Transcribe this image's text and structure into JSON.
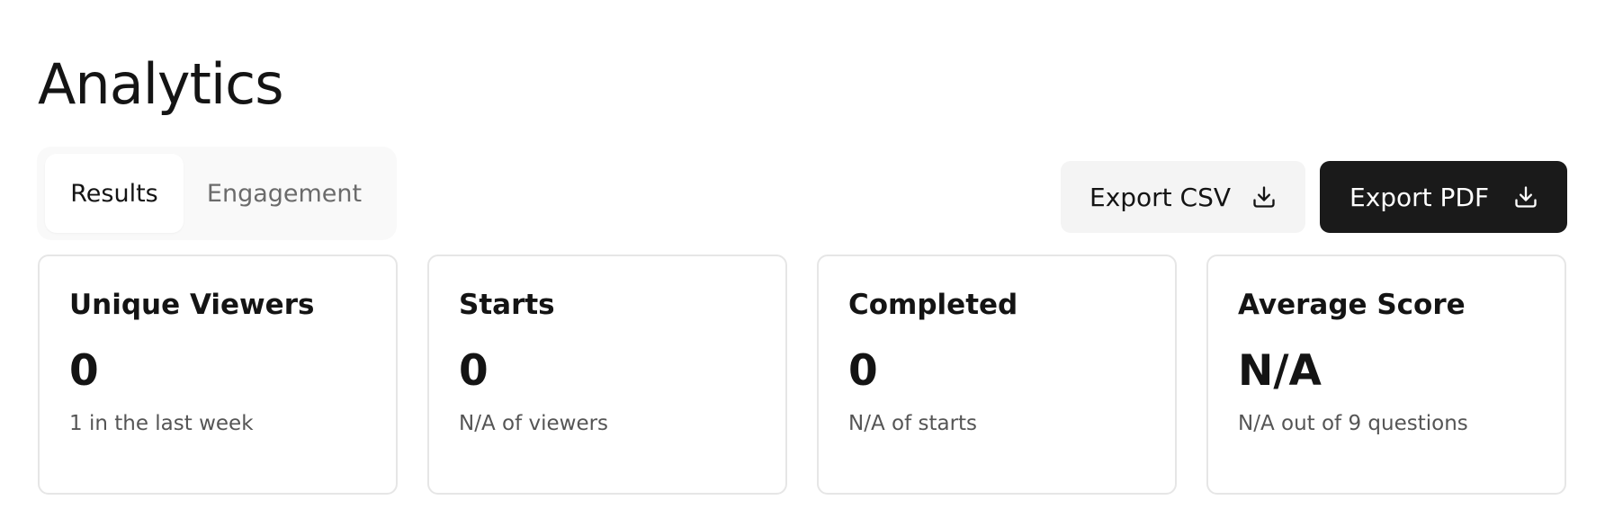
{
  "header": {
    "title": "Analytics"
  },
  "tabs": [
    {
      "label": "Results",
      "active": true
    },
    {
      "label": "Engagement",
      "active": false
    }
  ],
  "actions": {
    "export_csv": {
      "label": "Export CSV",
      "icon": "download-icon"
    },
    "export_pdf": {
      "label": "Export PDF",
      "icon": "download-icon"
    }
  },
  "stats": [
    {
      "title": "Unique Viewers",
      "value": "0",
      "sub": "1 in the last week"
    },
    {
      "title": "Starts",
      "value": "0",
      "sub": "N/A of viewers"
    },
    {
      "title": "Completed",
      "value": "0",
      "sub": "N/A of starts"
    },
    {
      "title": "Average Score",
      "value": "N/A",
      "sub": "N/A out of 9 questions"
    }
  ],
  "colors": {
    "primary_button_bg": "#1a1a1a",
    "secondary_button_bg": "#f4f4f4",
    "card_border": "#e6e6e6",
    "tab_bar_bg": "#f9f9f9"
  }
}
